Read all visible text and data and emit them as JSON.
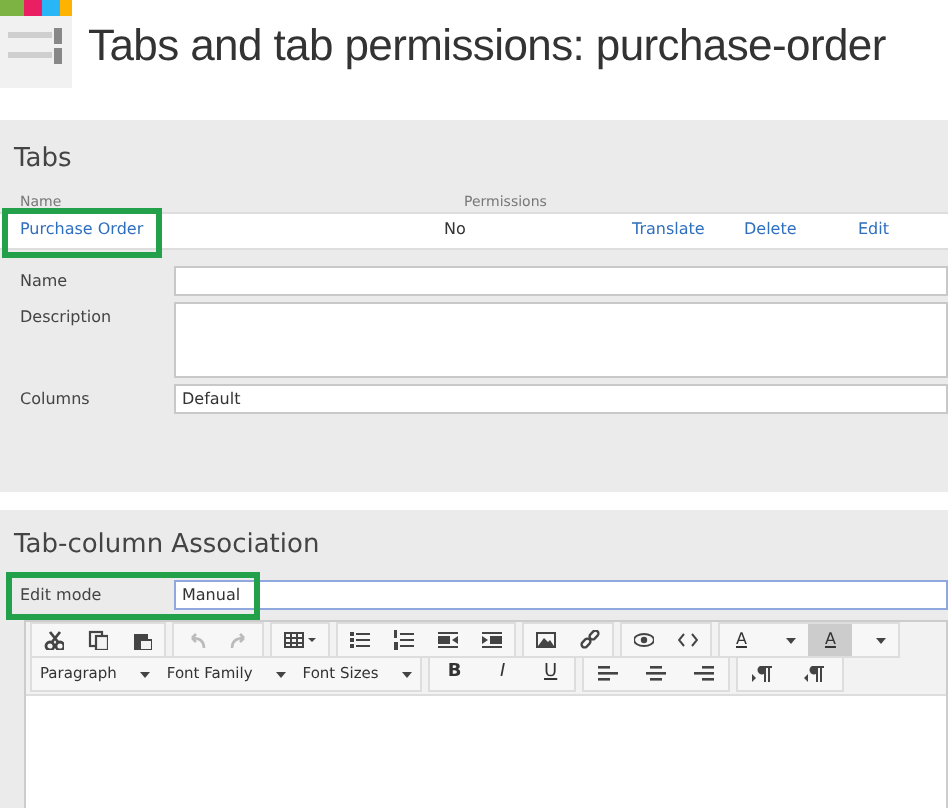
{
  "page_title": "Tabs and tab permissions: purchase-order",
  "tabs_panel": {
    "heading": "Tabs",
    "columns": [
      "Name",
      "Permissions"
    ],
    "rows": [
      {
        "name": "Purchase Order",
        "permissions": "No",
        "actions": [
          "Translate",
          "Delete",
          "Edit"
        ],
        "highlighted": true
      }
    ],
    "fields": [
      {
        "kind": "text",
        "label": "Name"
      },
      {
        "kind": "textarea",
        "label": "Description"
      },
      {
        "kind": "text",
        "label": "Columns",
        "value": "Default"
      }
    ]
  },
  "association_panel": {
    "heading": "Tab-column Association",
    "edit_mode": {
      "label": "Edit mode",
      "value": "Manual",
      "highlighted": true
    },
    "editor": {
      "history_disabled": true,
      "style_dropdowns": [
        "Paragraph",
        "Font Family",
        "Font Sizes"
      ],
      "format_buttons": [
        "B",
        "I",
        "U"
      ],
      "color_buttons": [
        "A",
        "A"
      ]
    }
  }
}
